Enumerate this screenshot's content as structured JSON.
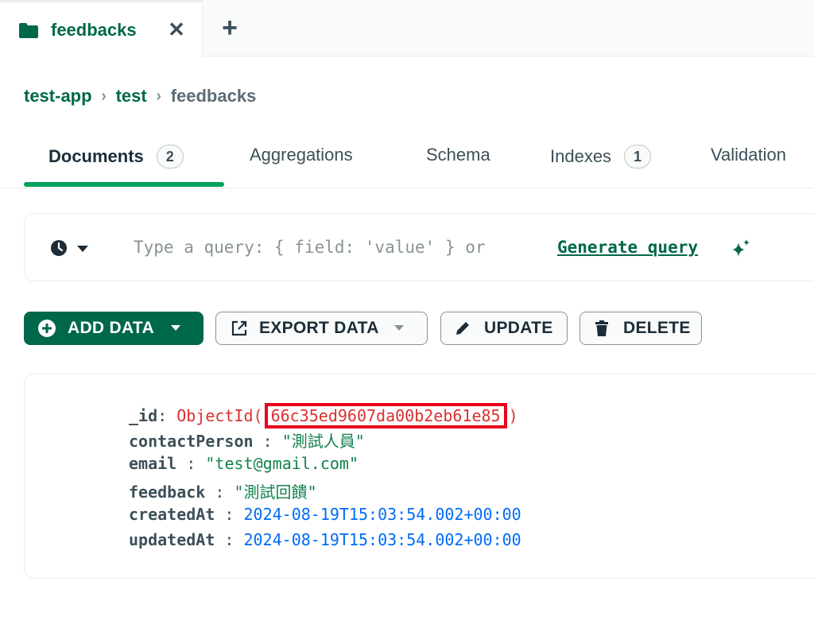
{
  "tab": {
    "label": "feedbacks",
    "close_label": "✕",
    "add_label": "+"
  },
  "breadcrumb": {
    "items": [
      "test-app",
      "test",
      "feedbacks"
    ],
    "separator": "›"
  },
  "subtabs": [
    {
      "label": "Documents",
      "count": "2",
      "active": true
    },
    {
      "label": "Aggregations"
    },
    {
      "label": "Schema"
    },
    {
      "label": "Indexes",
      "count": "1"
    },
    {
      "label": "Validation"
    }
  ],
  "query": {
    "placeholder": "Type a query: { field: 'value' } or",
    "generate_link": "Generate query"
  },
  "toolbar": {
    "add_data": "ADD DATA",
    "export_data": "EXPORT DATA",
    "update": "UPDATE",
    "delete": "DELETE"
  },
  "document": {
    "fields": [
      {
        "key": "_id",
        "sep": ":",
        "prefix": "ObjectId(",
        "value": "66c35ed9607da00b2eb61e85",
        "suffix": ")",
        "type": "objectid"
      },
      {
        "key": "contactPerson",
        "sep": " :",
        "value": "\"測試人員\"",
        "type": "string"
      },
      {
        "key": "email",
        "sep": " :",
        "value": "\"test@gmail.com\"",
        "type": "string"
      },
      {
        "key": "feedback",
        "sep": " :",
        "value": "\"測試回饋\"",
        "type": "string"
      },
      {
        "key": "createdAt",
        "sep": " :",
        "value": "2024-08-19T15:03:54.002+00:00",
        "type": "date"
      },
      {
        "key": "updatedAt",
        "sep": " :",
        "value": "2024-08-19T15:03:54.002+00:00",
        "type": "date"
      }
    ]
  },
  "colors": {
    "brand_green": "#00684a",
    "tab_underline": "#00a35c",
    "string_value": "#12824d",
    "date_value": "#016bf8",
    "objectid_value": "#db3030",
    "highlight_box": "#e8001a"
  },
  "icons": [
    "folder-icon",
    "close-icon",
    "plus-icon",
    "chevron-right-icon",
    "history-icon",
    "caret-down-icon",
    "sparkle-icon",
    "plus-circle-icon",
    "export-icon",
    "pencil-icon",
    "trash-icon"
  ]
}
